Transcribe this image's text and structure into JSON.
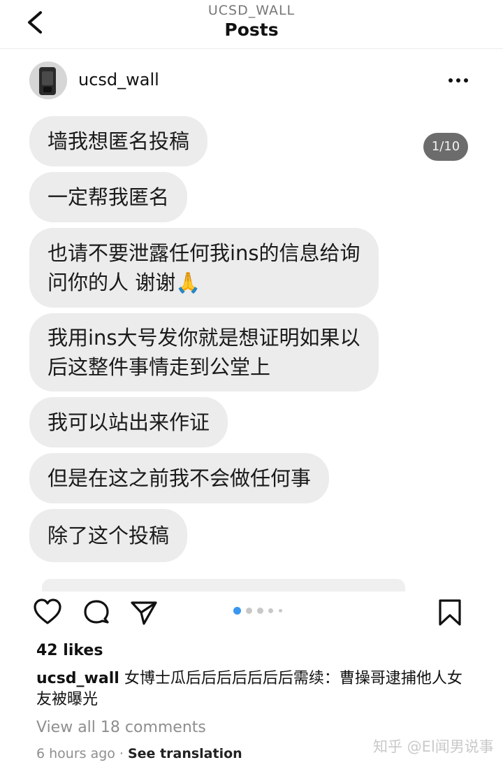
{
  "header": {
    "account": "UCSD_WALL",
    "title": "Posts"
  },
  "post": {
    "username": "ucsd_wall",
    "image_counter": "1/10",
    "messages": [
      "墙我想匿名投稿",
      "一定帮我匿名",
      "也请不要泄露任何我ins的信息给询\n问你的人 谢谢🙏",
      "我用ins大号发你就是想证明如果以\n后这整件事情走到公堂上",
      "我可以站出来作证",
      "但是在这之前我不会做任何事",
      "除了这个投稿"
    ],
    "likes": "42 likes",
    "caption_user": "ucsd_wall",
    "caption_text": "女博士瓜后后后后后后后需续：曹操哥逮捕他人女友被曝光",
    "view_comments": "View all 18 comments",
    "time_ago": "6 hours ago",
    "separator": "·",
    "see_translation": "See translation"
  },
  "watermark": "知乎 @El闻男说事",
  "icons": {
    "back": "chevron-left-icon",
    "more": "more-horizontal-icon",
    "like": "heart-icon",
    "comment": "comment-icon",
    "share": "send-icon",
    "save": "bookmark-icon"
  },
  "colors": {
    "bubble": "#ececed",
    "counter": "#6c6c6c",
    "active_dot": "#3897f0",
    "muted_text": "#8e8e8e"
  },
  "carousel": {
    "total": 10,
    "current": 1
  }
}
